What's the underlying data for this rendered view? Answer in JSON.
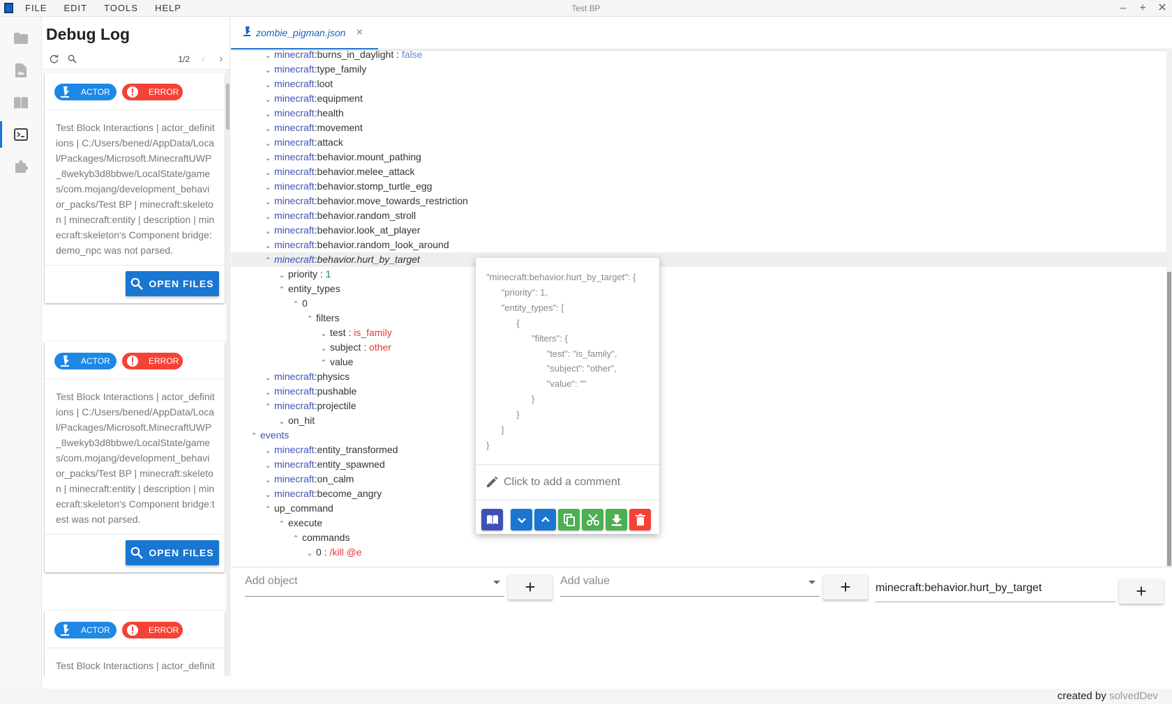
{
  "menu": [
    "FILE",
    "EDIT",
    "TOOLS",
    "HELP"
  ],
  "window": {
    "title": "Test BP",
    "controls": [
      "–",
      "+",
      "✕"
    ]
  },
  "sidebar": {
    "icons": [
      "folder-icon",
      "file-image-icon",
      "book-icon",
      "console-icon",
      "puzzle-icon"
    ],
    "active": "console-icon"
  },
  "debug": {
    "title": "Debug Log",
    "page": "1/2",
    "cards": [
      {
        "tag": "ACTOR",
        "level": "ERROR",
        "message": "Test Block Interactions | actor_definitions | C:/Users/bened/AppData/Local/Packages/Microsoft.MinecraftUWP_8wekyb3d8bbwe/LocalState/games/com.mojang/development_behavior_packs/Test BP | minecraft:skeleton | minecraft:entity | description | minecraft:skeleton's Component bridge:demo_npc was not parsed.",
        "button": "OPEN FILES"
      },
      {
        "tag": "ACTOR",
        "level": "ERROR",
        "message": "Test Block Interactions | actor_definitions | C:/Users/bened/AppData/Local/Packages/Microsoft.MinecraftUWP_8wekyb3d8bbwe/LocalState/games/com.mojang/development_behavior_packs/Test BP | minecraft:skeleton | minecraft:entity | description | minecraft:skeleton's Component bridge:test was not parsed.",
        "button": "OPEN FILES"
      },
      {
        "tag": "ACTOR",
        "level": "ERROR",
        "message": "Test Block Interactions | actor_definitions |",
        "button": "OPEN FILES"
      }
    ]
  },
  "tab": {
    "name": "zombie_pigman.json",
    "close": "×"
  },
  "tree": [
    {
      "indent": 2,
      "caret": "v",
      "ns": "minecraft",
      "key": ":burns_in_daylight",
      "sep": " : ",
      "value": "false",
      "vtype": "bool"
    },
    {
      "indent": 2,
      "caret": "v",
      "ns": "minecraft",
      "key": ":type_family"
    },
    {
      "indent": 2,
      "caret": "v",
      "ns": "minecraft",
      "key": ":loot"
    },
    {
      "indent": 2,
      "caret": "v",
      "ns": "minecraft",
      "key": ":equipment"
    },
    {
      "indent": 2,
      "caret": "v",
      "ns": "minecraft",
      "key": ":health"
    },
    {
      "indent": 2,
      "caret": "v",
      "ns": "minecraft",
      "key": ":movement"
    },
    {
      "indent": 2,
      "caret": "v",
      "ns": "minecraft",
      "key": ":attack"
    },
    {
      "indent": 2,
      "caret": "v",
      "ns": "minecraft",
      "key": ":behavior.mount_pathing"
    },
    {
      "indent": 2,
      "caret": "v",
      "ns": "minecraft",
      "key": ":behavior.melee_attack"
    },
    {
      "indent": 2,
      "caret": "v",
      "ns": "minecraft",
      "key": ":behavior.stomp_turtle_egg"
    },
    {
      "indent": 2,
      "caret": "v",
      "ns": "minecraft",
      "key": ":behavior.move_towards_restriction"
    },
    {
      "indent": 2,
      "caret": "v",
      "ns": "minecraft",
      "key": ":behavior.random_stroll"
    },
    {
      "indent": 2,
      "caret": "v",
      "ns": "minecraft",
      "key": ":behavior.look_at_player"
    },
    {
      "indent": 2,
      "caret": "v",
      "ns": "minecraft",
      "key": ":behavior.random_look_around"
    },
    {
      "indent": 2,
      "caret": "^",
      "ns": "minecraft",
      "key": ":behavior.hurt_by_target",
      "selected": true
    },
    {
      "indent": 3,
      "caret": "v",
      "key": "priority",
      "sep": " : ",
      "value": "1",
      "vtype": "num"
    },
    {
      "indent": 3,
      "caret": "^",
      "key": "entity_types"
    },
    {
      "indent": 4,
      "caret": "^",
      "key": "0"
    },
    {
      "indent": 5,
      "caret": "^",
      "key": "filters"
    },
    {
      "indent": 6,
      "caret": "v",
      "key": "test",
      "sep": " : ",
      "value": "is_family",
      "vtype": "str"
    },
    {
      "indent": 6,
      "caret": "v",
      "key": "subject",
      "sep": " : ",
      "value": "other",
      "vtype": "str"
    },
    {
      "indent": 6,
      "caret": "^",
      "key": "value"
    },
    {
      "indent": 2,
      "caret": "v",
      "ns": "minecraft",
      "key": ":physics"
    },
    {
      "indent": 2,
      "caret": "v",
      "ns": "minecraft",
      "key": ":pushable"
    },
    {
      "indent": 2,
      "caret": "^",
      "ns": "minecraft",
      "key": ":projectile"
    },
    {
      "indent": 3,
      "caret": "v",
      "key": "on_hit"
    },
    {
      "indent": 1,
      "caret": "^",
      "ns": "events",
      "key": ""
    },
    {
      "indent": 2,
      "caret": "v",
      "ns": "minecraft",
      "key": ":entity_transformed"
    },
    {
      "indent": 2,
      "caret": "v",
      "ns": "minecraft",
      "key": ":entity_spawned"
    },
    {
      "indent": 2,
      "caret": "v",
      "ns": "minecraft",
      "key": ":on_calm"
    },
    {
      "indent": 2,
      "caret": "v",
      "ns": "minecraft",
      "key": ":become_angry"
    },
    {
      "indent": 2,
      "caret": "^",
      "key": "up_command"
    },
    {
      "indent": 3,
      "caret": "^",
      "key": "execute"
    },
    {
      "indent": 4,
      "caret": "^",
      "key": "commands"
    },
    {
      "indent": 5,
      "caret": "v",
      "key": "0",
      "sep": " : ",
      "value": "/kill @e",
      "vtype": "str"
    }
  ],
  "popup": {
    "code": "\"minecraft:behavior.hurt_by_target\": {\n      \"priority\": 1,\n      \"entity_types\": [\n            {\n                  \"filters\": {\n                        \"test\": \"is_family\",\n                        \"subject\": \"other\",\n                        \"value\": \"\"\n                  }\n            }\n      ]\n}",
    "comment_placeholder": "Click to add a comment",
    "buttons": [
      {
        "icon": "book-open-icon",
        "color": "#3f51b5"
      },
      {
        "icon": "chevron-down-icon",
        "color": "#1976d2"
      },
      {
        "icon": "chevron-up-icon",
        "color": "#1976d2"
      },
      {
        "icon": "copy-icon",
        "color": "#4caf50"
      },
      {
        "icon": "scissors-icon",
        "color": "#4caf50"
      },
      {
        "icon": "download-icon",
        "color": "#4caf50"
      },
      {
        "icon": "delete-icon",
        "color": "#f44336"
      }
    ]
  },
  "inputs": {
    "add_object_placeholder": "Add object",
    "add_value_placeholder": "Add value",
    "edit_value": "minecraft:behavior.hurt_by_target",
    "plus": "+"
  },
  "footer": {
    "credit_prefix": "created by ",
    "credit_name": "solvedDev"
  },
  "colors": {
    "accent": "#1976d2",
    "error": "#f44336",
    "namespace": "#3f51b5",
    "string": "#e53935",
    "number": "#2e7d32"
  }
}
